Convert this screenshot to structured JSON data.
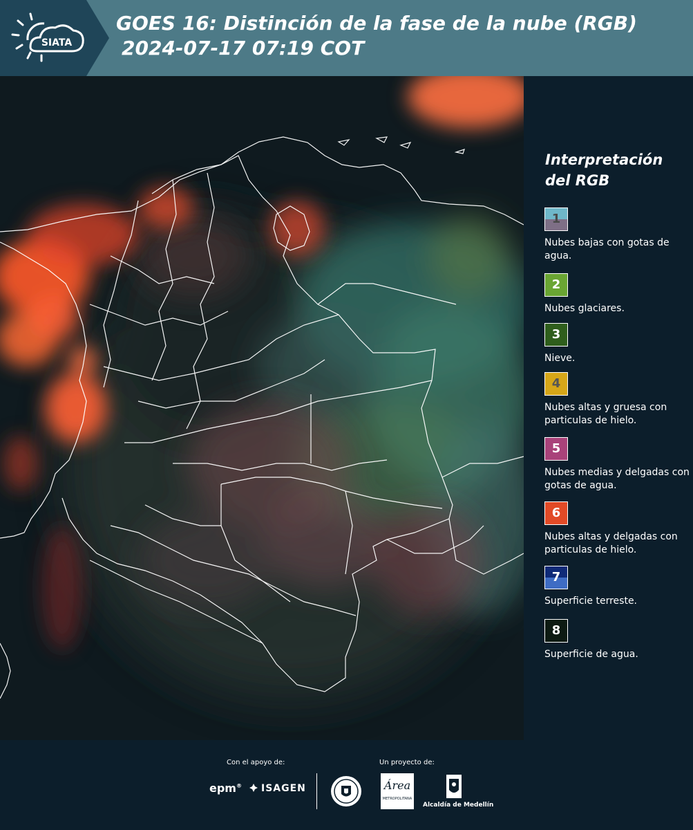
{
  "header": {
    "logo_text": "SIATA",
    "title_line1": "GOES 16: Distinción de la fase de la nube (RGB)",
    "title_line2": "2024-07-17 07:19 COT",
    "band_color": "#4d7a87",
    "logo_band_color": "#1f4558"
  },
  "map": {
    "description_icon": "satellite-rgb-map",
    "water_color": "#0f1a1f",
    "boundary_color": "#ffffff"
  },
  "legend": {
    "title": "Interpretación del RGB",
    "items": [
      {
        "num": "1",
        "label": "Nubes bajas con gotas de agua.",
        "top_color": "#6fb7c9",
        "bottom_color": "#7e6f86",
        "num_color": "#4a4a4a"
      },
      {
        "num": "2",
        "label": "Nubes glaciares.",
        "top_color": "#6aa533",
        "bottom_color": "#6aa533",
        "num_color": "#ffffff"
      },
      {
        "num": "3",
        "label": "Nieve.",
        "top_color": "#2f5e1c",
        "bottom_color": "#2f5e1c",
        "num_color": "#ffffff"
      },
      {
        "num": "4",
        "label": "Nubes altas y gruesa con particulas de hielo.",
        "top_color": "#d6a618",
        "bottom_color": "#d6a618",
        "num_color": "#555555"
      },
      {
        "num": "5",
        "label": "Nubes medias y delgadas con gotas de agua.",
        "top_color": "#a9427a",
        "bottom_color": "#a9427a",
        "num_color": "#ffffff"
      },
      {
        "num": "6",
        "label": "Nubes altas y delgadas con particulas de hielo.",
        "top_color": "#e24a26",
        "bottom_color": "#e24a26",
        "num_color": "#ffffff"
      },
      {
        "num": "7",
        "label": "Superficie terreste.",
        "top_color": "#0f2a78",
        "bottom_color": "#3e6cc4",
        "num_color": "#ffffff"
      },
      {
        "num": "8",
        "label": "Superficie de agua.",
        "top_color": "#0d1a12",
        "bottom_color": "#0d1a12",
        "num_color": "#ffffff"
      }
    ]
  },
  "footer": {
    "support_label": "Con el apoyo de:",
    "project_label": "Un proyecto de:",
    "epm": "epm",
    "epm_sup": "®",
    "isagen": "ISAGEN",
    "amva_main": "Área",
    "amva_sub": "METROPOLITANA",
    "alcaldia": "Alcaldía de Medellín"
  }
}
